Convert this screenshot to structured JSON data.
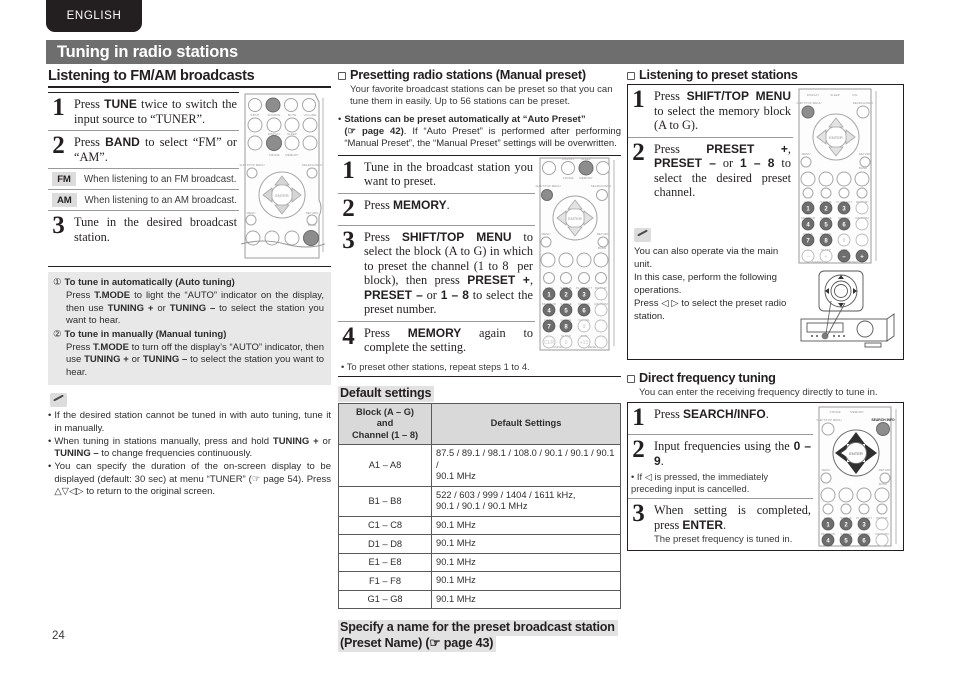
{
  "page": {
    "language_tab": "ENGLISH",
    "chapter_title": "Tuning in radio stations",
    "page_number": "24"
  },
  "col1": {
    "heading": "Listening to FM/AM broadcasts",
    "steps": [
      {
        "num": "1",
        "html": "Press <b>TUNE</b> twice to switch the input source to “TUNER”."
      },
      {
        "num": "2",
        "html": "Press <b>BAND</b> to select “FM” or “AM”."
      },
      {
        "num": "3",
        "html": "Tune in the desired broadcast station."
      }
    ],
    "badges": [
      {
        "label": "FM",
        "desc": "When listening to an FM broadcast."
      },
      {
        "label": "AM",
        "desc": "When listening to an AM broadcast."
      }
    ],
    "tuning_modes": [
      {
        "marker": "①",
        "title": "To tune in automatically (Auto tuning)",
        "body": "Press T.MODE to light the “AUTO” indicator on the display, then use TUNING + or TUNING – to select the station you want to hear."
      },
      {
        "marker": "②",
        "title": "To tune in manually (Manual tuning)",
        "body": "Press T.MODE to turn off the display’s “AUTO” indicator, then use TUNING + or TUNING – to select the station you want to hear."
      }
    ],
    "note_bullets": [
      "If the desired station cannot be tuned in with auto tuning, tune it in manually.",
      "When tuning in stations manually, press and hold TUNING + or TUNING – to change frequencies continuously.",
      "You can specify the duration of the on-screen display to be displayed (default: 30 sec) at menu “TUNER” (☞ page 54). Press △ ▽ ◁ ▷ to return to the original screen."
    ]
  },
  "col2": {
    "heading": "Presetting radio stations (Manual preset)",
    "intro": "Your favorite broadcast stations can be preset so that you can tune them in easily. Up to 56 stations can be preset.",
    "bullet_note": "Stations can be preset automatically at “Auto Preset” (☞ page 42). If “Auto Preset” is performed after performing “Manual Preset”, the “Manual Preset” settings will be overwritten.",
    "bullet_note_bold": "Stations can be preset automatically at “Auto Preset”",
    "bullet_note_ref": "(☞ page 42)",
    "bullet_note_rest": ". If “Auto Preset” is performed after performing “Manual Preset”, the “Manual Preset” settings will be overwritten.",
    "steps": [
      {
        "num": "1",
        "html": "Tune in the broadcast station you want to preset."
      },
      {
        "num": "2",
        "html": "Press <b>MEMORY</b>."
      },
      {
        "num": "3",
        "html": "Press <b>SHIFT/TOP MENU</b> to select the block (A to G) in which to preset the channel (1 to 8  per block), then press <b>PRESET +</b>, <b>PRESET –</b> or <b>1 – 8</b> to select the preset number."
      },
      {
        "num": "4",
        "html": "Press <b>MEMORY</b> again to complete the setting."
      }
    ],
    "step4_note": "To preset other stations, repeat steps 1 to 4.",
    "defaults_heading": "Default settings",
    "table": {
      "headers": [
        "Block (A – G)\nand\nChannel (1 – 8)",
        "Default Settings"
      ],
      "header_block_lines": [
        "Block (A – G)",
        "and",
        "Channel (1 – 8)"
      ],
      "header_settings": "Default Settings",
      "rows": [
        {
          "block": "A1 – A8",
          "settings": "87.5 / 89.1 / 98.1 / 108.0 / 90.1 / 90.1 / 90.1 / 90.1 MHz"
        },
        {
          "block": "B1 – B8",
          "settings": "522 / 603 / 999 / 1404 / 1611 kHz,\n90.1 / 90.1 / 90.1 MHz"
        },
        {
          "block": "C1 – C8",
          "settings": "90.1 MHz"
        },
        {
          "block": "D1 – D8",
          "settings": "90.1 MHz"
        },
        {
          "block": "E1 – E8",
          "settings": "90.1 MHz"
        },
        {
          "block": "F1 – F8",
          "settings": "90.1 MHz"
        },
        {
          "block": "G1 – G8",
          "settings": "90.1 MHz"
        }
      ]
    },
    "preset_name_line1": "Specify a name for the preset broadcast station",
    "preset_name_line2a": "(Preset Name) (",
    "preset_name_ref": "☞ page 43",
    "preset_name_line2b": ")"
  },
  "col3": {
    "heading_listening": "Listening to preset stations",
    "steps_listening": [
      {
        "num": "1",
        "html": "Press <b>SHIFT/TOP MENU</b> to select the memory block (A to G)."
      },
      {
        "num": "2",
        "html": "Press <b>PRESET +</b>, <b>PRESET –</b> or <b>1 – 8</b> to select the desired preset channel."
      }
    ],
    "main_unit_note": "You can also operate via the main unit.\nIn this case, perform the following operations.\nPress ◁ ▷ to select the preset radio station.",
    "main_unit_note_lines": [
      "You can also operate via the main unit.",
      "In this case, perform the following",
      "operations.",
      "Press ◁ ▷ to select the preset radio",
      "station."
    ],
    "heading_direct": "Direct frequency tuning",
    "direct_intro": "You can enter the receiving frequency directly to tune in.",
    "steps_direct": [
      {
        "num": "1",
        "html": "Press <b>SEARCH/INFO</b>."
      },
      {
        "num": "2",
        "html": "Input frequencies using the <b>0 – 9</b>."
      },
      {
        "num": "3",
        "html": "When setting is completed, press <b>ENTER</b>."
      }
    ],
    "direct_step2_note": "If ◁ is pressed, the immediately preceding input is cancelled.",
    "direct_step3_note": "The preset frequency is tuned in."
  },
  "remote_labels": {
    "numbers": [
      "1",
      "2",
      "3",
      "4",
      "5",
      "6",
      "7",
      "8",
      "9",
      "0"
    ],
    "keys": [
      "SHIFT/TOP MENU",
      "SEARCH/INFO",
      "MENU",
      "RETURN",
      "ENTER",
      "BAND",
      "MEMORY",
      "T.MODE",
      "TUNE",
      "TUNING",
      "PRESET",
      "CLR",
      "+10",
      "CHANNEL"
    ]
  },
  "colors": {
    "chapter_bar": "#6e6e6e",
    "tab_bg": "#231f20",
    "table_header": "#d9d9d9",
    "grey_block": "#e8e8e8",
    "highlight": "#e2e2e2"
  }
}
